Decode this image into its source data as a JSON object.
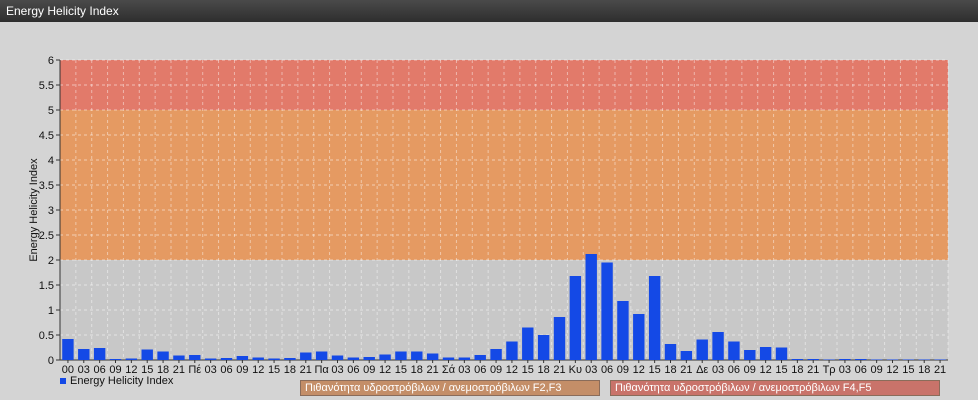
{
  "window": {
    "title": "Energy Helicity Index"
  },
  "legend": {
    "series_label": "Energy Helicity Index",
    "series_color": "#1449e6"
  },
  "bands": [
    {
      "from": 2,
      "to": 5,
      "color": "#e59a62",
      "label": "Πιθανότητα υδροστρόβιλων / ανεμοστρόβιλων F2,F3"
    },
    {
      "from": 5,
      "to": 6,
      "color": "#e27a6a",
      "label": "Πιθανότητα υδροστρόβιλων / ανεμοστρόβιλων F4,F5"
    }
  ],
  "chart_data": {
    "type": "bar",
    "title": "",
    "xlabel": "",
    "ylabel": "Energy Helicity Index",
    "ylim": [
      0,
      6
    ],
    "yticks": [
      "0",
      "0.5",
      "1",
      "1.5",
      "2",
      "2.5",
      "3",
      "3.5",
      "4",
      "4.5",
      "5",
      "5.5",
      "6"
    ],
    "grid": true,
    "legend_position": "bottom-left",
    "categories": [
      "00",
      "03",
      "06",
      "09",
      "12",
      "15",
      "18",
      "21",
      "Πέ",
      "03",
      "06",
      "09",
      "12",
      "15",
      "18",
      "21",
      "Πα",
      "03",
      "06",
      "09",
      "12",
      "15",
      "18",
      "21",
      "Σά",
      "03",
      "06",
      "09",
      "12",
      "15",
      "18",
      "21",
      "Κυ",
      "03",
      "06",
      "09",
      "12",
      "15",
      "18",
      "21",
      "Δε",
      "03",
      "06",
      "09",
      "12",
      "15",
      "18",
      "21",
      "Τρ",
      "03",
      "06",
      "09",
      "12",
      "15",
      "18",
      "21"
    ],
    "series": [
      {
        "name": "Energy Helicity Index",
        "values": [
          0.42,
          0.22,
          0.24,
          0.02,
          0.03,
          0.21,
          0.17,
          0.09,
          0.1,
          0.03,
          0.04,
          0.08,
          0.05,
          0.03,
          0.04,
          0.15,
          0.17,
          0.09,
          0.05,
          0.06,
          0.11,
          0.17,
          0.17,
          0.13,
          0.05,
          0.05,
          0.1,
          0.22,
          0.37,
          0.65,
          0.5,
          0.86,
          1.68,
          2.12,
          1.95,
          1.18,
          0.92,
          1.68,
          0.32,
          0.18,
          0.41,
          0.56,
          0.37,
          0.2,
          0.26,
          0.25,
          0.02,
          0.02,
          0.01,
          0.02,
          0.02,
          0.01,
          0.01,
          0.01,
          0.01,
          0.01
        ]
      }
    ]
  }
}
